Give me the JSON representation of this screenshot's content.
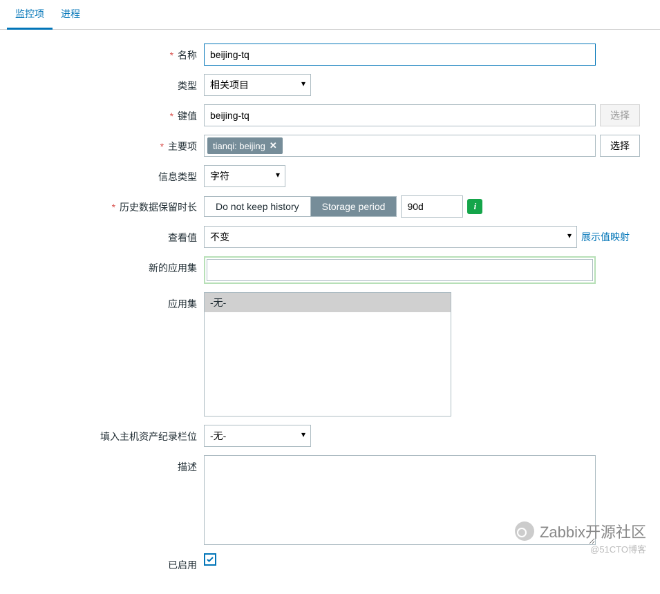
{
  "tabs": {
    "monitoring": "监控项",
    "process": "进程"
  },
  "labels": {
    "name": "名称",
    "type": "类型",
    "key": "键值",
    "master": "主要项",
    "info_type": "信息类型",
    "history": "历史数据保留时长",
    "view_value": "查看值",
    "new_app": "新的应用集",
    "app": "应用集",
    "inventory": "填入主机资产纪录栏位",
    "description": "描述",
    "enabled": "已启用"
  },
  "values": {
    "name": "beijing-tq",
    "type": "相关项目",
    "key": "beijing-tq",
    "master_tag": "tianqi: beijing",
    "info_type": "字符",
    "history_opt1": "Do not keep history",
    "history_opt2": "Storage period",
    "history_val": "90d",
    "view_value": "不变",
    "view_link": "展示值映射",
    "new_app": "",
    "app_none": "-无-",
    "inventory": "-无-",
    "description": ""
  },
  "buttons": {
    "select": "选择",
    "select_disabled": "选择"
  },
  "icons": {
    "info": "i",
    "close": "✕",
    "check": "check"
  },
  "watermark": {
    "main": "Zabbix开源社区",
    "sub": "@51CTO博客"
  }
}
